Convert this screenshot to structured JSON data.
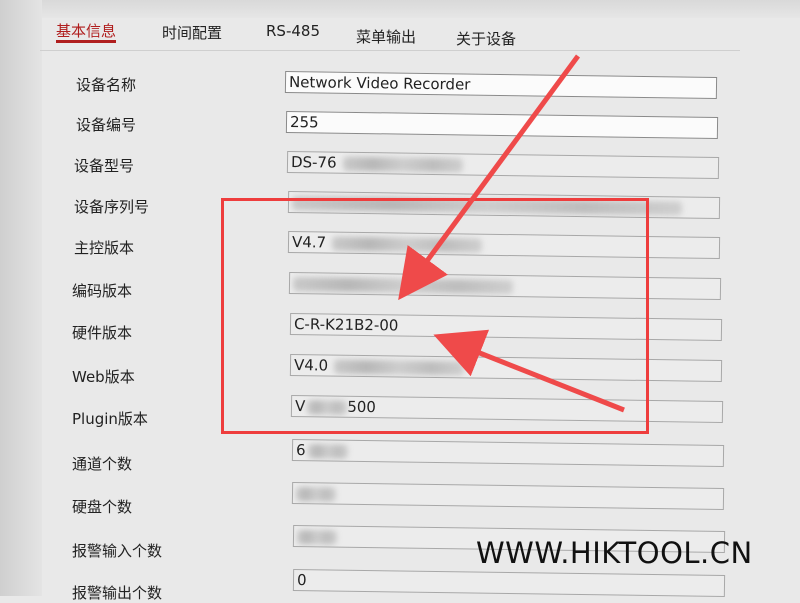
{
  "tabs": [
    {
      "label": "基本信息",
      "active": true
    },
    {
      "label": "时间配置",
      "active": false
    },
    {
      "label": "RS-485",
      "active": false
    },
    {
      "label": "菜单输出",
      "active": false
    },
    {
      "label": "关于设备",
      "active": false
    }
  ],
  "fields": {
    "device_name": {
      "label": "设备名称",
      "value": "Network Video Recorder"
    },
    "device_no": {
      "label": "设备编号",
      "value": "255"
    },
    "device_model": {
      "label": "设备型号",
      "value": "DS-76"
    },
    "serial_no": {
      "label": "设备序列号",
      "value": ""
    },
    "main_version": {
      "label": "主控版本",
      "value": "V4.7"
    },
    "encode_version": {
      "label": "编码版本",
      "value": ""
    },
    "hardware_version": {
      "label": "硬件版本",
      "value": "C-R-K21B2-00"
    },
    "web_version": {
      "label": "Web版本",
      "value": "V4.0"
    },
    "plugin_version": {
      "label": "Plugin版本",
      "value": "V",
      "suffix": "500"
    },
    "channels": {
      "label": "通道个数",
      "value": "6"
    },
    "disks": {
      "label": "硬盘个数",
      "value": ""
    },
    "alarm_in": {
      "label": "报警输入个数",
      "value": ""
    },
    "alarm_out": {
      "label": "报警输出个数",
      "value": "0"
    }
  },
  "watermark": "WWW.HIKTOOL.CN",
  "colors": {
    "accent": "#b01e1e",
    "highlight": "#ee3d3d"
  }
}
